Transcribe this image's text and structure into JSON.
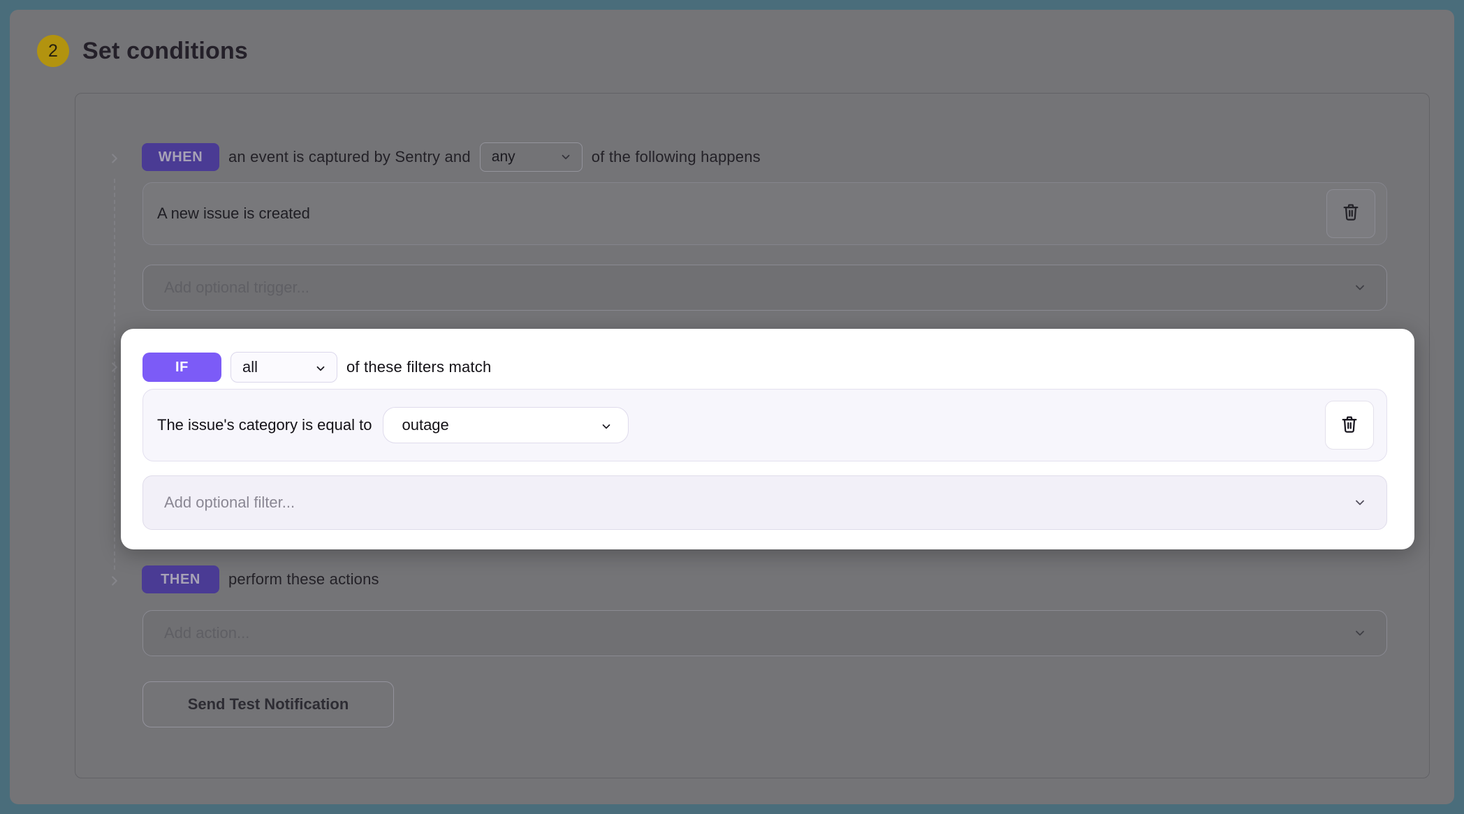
{
  "header": {
    "step_number": "2",
    "title": "Set conditions"
  },
  "when": {
    "badge": "WHEN",
    "text_before": "an event is captured by Sentry and",
    "select_value": "any",
    "text_after": "of the following happens",
    "trigger_label": "A new issue is created",
    "add_placeholder": "Add optional trigger..."
  },
  "if": {
    "badge": "IF",
    "select_value": "all",
    "text_after": "of these filters match",
    "filter_label": "The issue's category is equal to",
    "filter_select_value": "outage",
    "add_placeholder": "Add optional filter..."
  },
  "then": {
    "badge": "THEN",
    "text_after": "perform these actions",
    "add_placeholder": "Add action..."
  },
  "actions": {
    "send_test_label": "Send Test Notification"
  },
  "icons": {
    "trash": "trash-icon",
    "chevron_down": "chevron-down-icon",
    "chevron_right": "chevron-right-icon"
  },
  "colors": {
    "frame_teal": "#4A6D7B",
    "overlay_gray": "#747477",
    "accent_purple": "#7C5BF7",
    "dim_badge_purple": "#4A3B94",
    "step_gold": "#B2930F",
    "highlight_bg": "#FFFFFF"
  }
}
